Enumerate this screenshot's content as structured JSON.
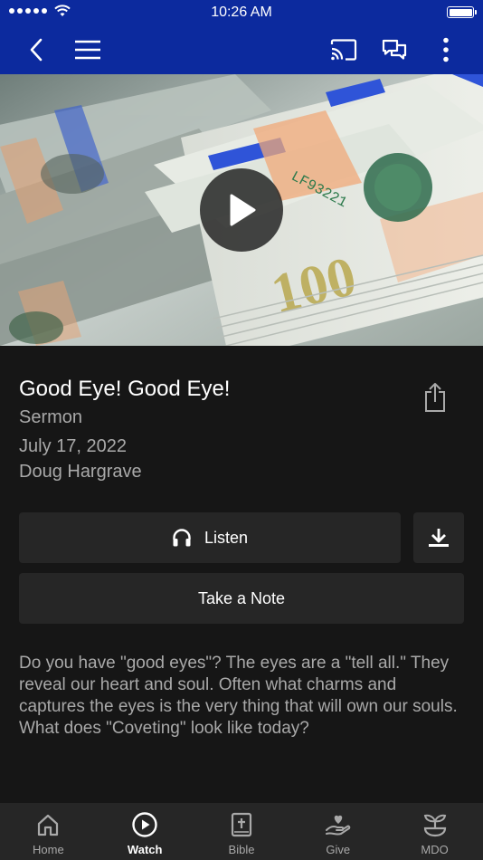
{
  "status_bar": {
    "time": "10:26 AM"
  },
  "nav": {
    "icons": [
      "back-icon",
      "menu-icon",
      "cast-icon",
      "chat-icon",
      "more-icon"
    ]
  },
  "video": {
    "thumbnail_subject": "stack of hundred dollar bills",
    "play_icon": "play-icon"
  },
  "sermon": {
    "title": "Good Eye! Good Eye!",
    "category": "Sermon",
    "date": "July 17, 2022",
    "speaker": "Doug Hargrave"
  },
  "actions": {
    "listen_label": "Listen",
    "note_label": "Take a Note",
    "download_icon": "download-icon",
    "share_icon": "share-icon"
  },
  "description": "Do you have \"good eyes\"? The eyes are a \"tell all.\" They reveal our heart and soul. Often what charms and captures the eyes is the very thing that will own our souls.\nWhat does \"Coveting\" look like today?",
  "tabs": [
    {
      "label": "Home",
      "icon": "home-icon",
      "active": false
    },
    {
      "label": "Watch",
      "icon": "play-circle-icon",
      "active": true
    },
    {
      "label": "Bible",
      "icon": "bible-icon",
      "active": false
    },
    {
      "label": "Give",
      "icon": "give-icon",
      "active": false
    },
    {
      "label": "MDO",
      "icon": "sprout-icon",
      "active": false
    }
  ],
  "colors": {
    "header": "#0c2a9e",
    "background": "#161616",
    "surface": "#262626",
    "muted_text": "#a9a9a9"
  }
}
